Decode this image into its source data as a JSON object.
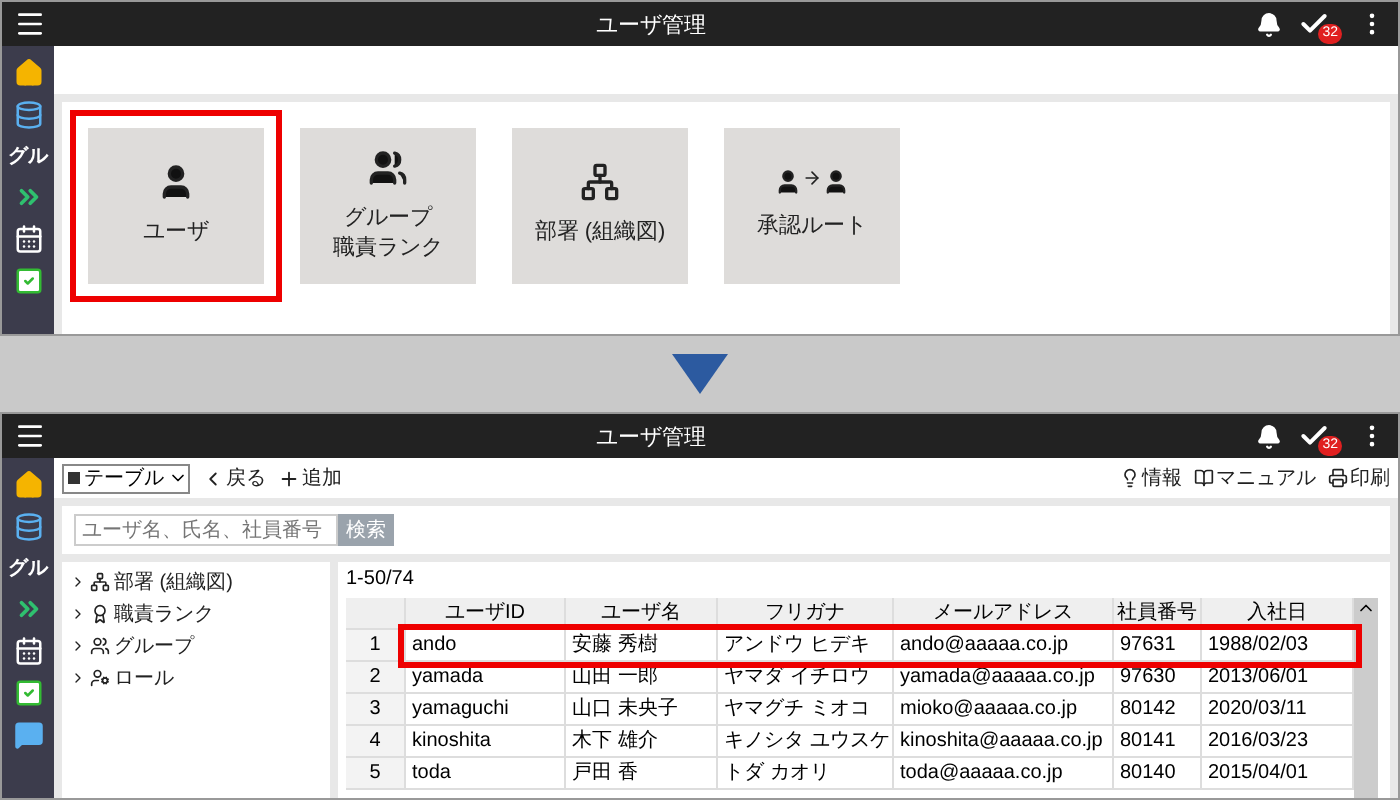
{
  "top": {
    "title": "ユーザ管理",
    "badge": "32",
    "sidebar_label": "グル",
    "tiles": [
      {
        "lines": [
          "ユーザ"
        ],
        "highlighted": true
      },
      {
        "lines": [
          "グループ",
          "職責ランク"
        ],
        "highlighted": false
      },
      {
        "lines": [
          "部署 (組織図)"
        ],
        "highlighted": false
      },
      {
        "lines": [
          "承認ルート"
        ],
        "highlighted": false
      }
    ]
  },
  "bottom": {
    "title": "ユーザ管理",
    "badge": "32",
    "sidebar_label": "グル",
    "view_select": "テーブル",
    "back": "戻る",
    "add": "追加",
    "links": [
      "情報",
      "マニュアル",
      "印刷"
    ],
    "search": {
      "placeholder": "ユーザ名、氏名、社員番号",
      "button": "検索"
    },
    "tree": [
      "部署 (組織図)",
      "職責ランク",
      "グループ",
      "ロール"
    ],
    "count": "1-50/74",
    "columns": [
      "",
      "ユーザID",
      "ユーザ名",
      "フリガナ",
      "メールアドレス",
      "社員番号",
      "入社日"
    ],
    "rows": [
      {
        "cells": [
          "1",
          "ando",
          "安藤 秀樹",
          "アンドウ ヒデキ",
          "ando@aaaaa.co.jp",
          "97631",
          "1988/02/03"
        ],
        "highlighted": true
      },
      {
        "cells": [
          "2",
          "yamada",
          "山田 一郎",
          "ヤマダ イチロウ",
          "yamada@aaaaa.co.jp",
          "97630",
          "2013/06/01"
        ],
        "highlighted": false
      },
      {
        "cells": [
          "3",
          "yamaguchi",
          "山口 未央子",
          "ヤマグチ ミオコ",
          "mioko@aaaaa.co.jp",
          "80142",
          "2020/03/11"
        ],
        "highlighted": false
      },
      {
        "cells": [
          "4",
          "kinoshita",
          "木下 雄介",
          "キノシタ ユウスケ",
          "kinoshita@aaaaa.co.jp",
          "80141",
          "2016/03/23"
        ],
        "highlighted": false
      },
      {
        "cells": [
          "5",
          "toda",
          "戸田 香",
          "トダ カオリ",
          "toda@aaaaa.co.jp",
          "80140",
          "2015/04/01"
        ],
        "highlighted": false
      }
    ]
  }
}
